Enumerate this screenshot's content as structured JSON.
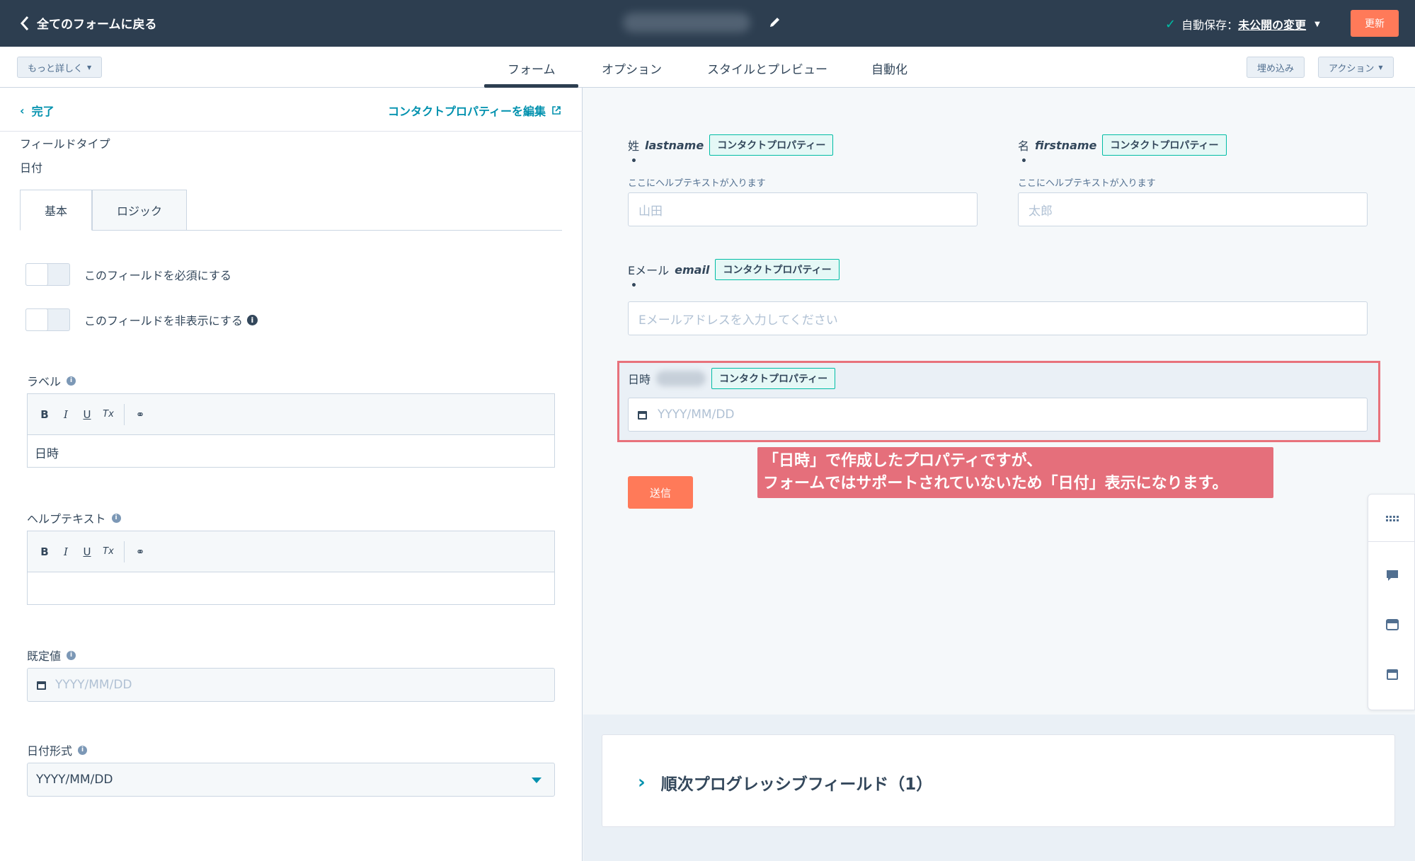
{
  "topbar": {
    "back_label": "全てのフォームに戻る",
    "autosave_label": "自動保存：",
    "autosave_link": "未公開の変更",
    "update_button": "更新"
  },
  "tabbar": {
    "more_label": "もっと詳しく",
    "tabs": [
      "フォーム",
      "オプション",
      "スタイルとプレビュー",
      "自動化"
    ],
    "embed_label": "埋め込み",
    "action_label": "アクション"
  },
  "left": {
    "done_label": "完了",
    "edit_property_label": "コンタクトプロパティーを編集",
    "field_type_label": "フィールドタイプ",
    "field_type_value": "日付",
    "subtabs": [
      "基本",
      "ロジック"
    ],
    "toggle_required": "このフィールドを必須にする",
    "toggle_hidden": "このフィールドを非表示にする",
    "label_section": "ラベル",
    "label_value": "日時",
    "help_section": "ヘルプテキスト",
    "help_value": "",
    "default_section": "既定値",
    "default_placeholder": "YYYY/MM/DD",
    "format_section": "日付形式",
    "format_value": "YYYY/MM/DD",
    "rte_buttons": [
      "B",
      "I",
      "U",
      "Tx"
    ]
  },
  "preview": {
    "prop_tag": "コンタクトプロパティー",
    "lastname_label": "姓",
    "lastname_internal": "lastname",
    "lastname_help": "ここにヘルプテキストが入ります",
    "lastname_placeholder": "山田",
    "firstname_label": "名",
    "firstname_internal": "firstname",
    "firstname_help": "ここにヘルプテキストが入ります",
    "firstname_placeholder": "太郎",
    "email_label": "Eメール",
    "email_internal": "email",
    "email_placeholder": "Eメールアドレスを入力してください",
    "date_label": "日時",
    "date_placeholder": "YYYY/MM/DD",
    "required_mark": "•",
    "submit_label": "送信",
    "annotation_line1": "「日時」で作成したプロパティですが、",
    "annotation_line2": "フォームではサポートされていないため「日付」表示になります。",
    "progressive_label": "順次プログレッシブフィールド（1）"
  },
  "colors": {
    "topbar": "#2d3e50",
    "accent": "#ff7a59",
    "link": "#0091ae",
    "tag_border": "#00bda5",
    "annotation": "#e56f7b"
  }
}
